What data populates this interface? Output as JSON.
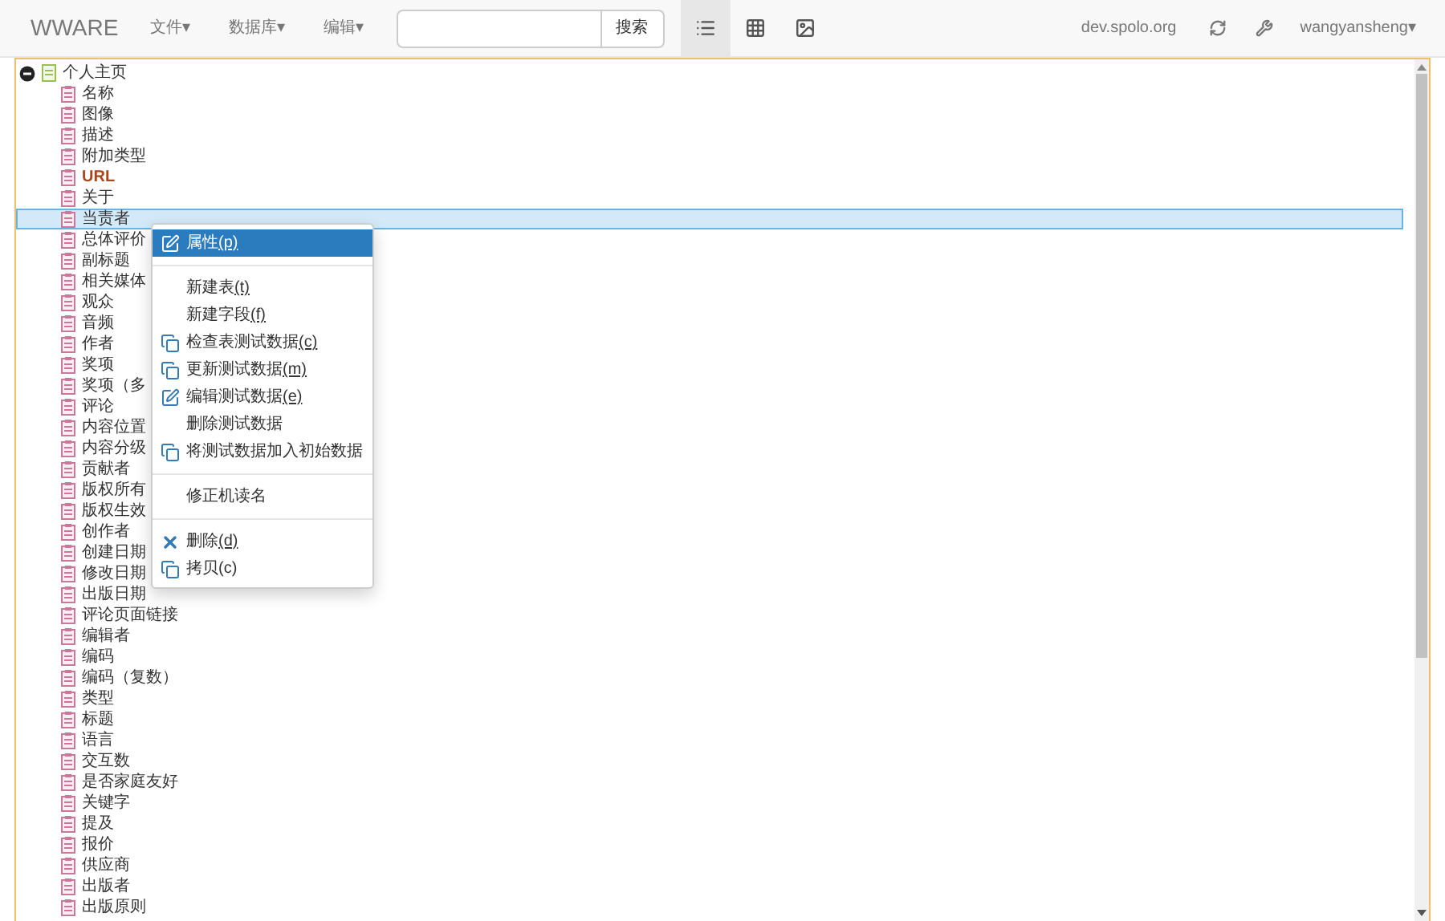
{
  "navbar": {
    "brand": "WWARE",
    "menus": [
      {
        "label": "文件",
        "caret": "▾"
      },
      {
        "label": "数据库",
        "caret": "▾"
      },
      {
        "label": "编辑",
        "caret": "▾"
      }
    ],
    "search": {
      "button": "搜索"
    },
    "views": [
      {
        "kind": "list",
        "selected": true
      },
      {
        "kind": "grid",
        "selected": false
      },
      {
        "kind": "image",
        "selected": false
      }
    ],
    "host": "dev.spolo.org",
    "user": {
      "name": "wangyansheng",
      "caret": "▾"
    }
  },
  "tree": {
    "label": "个人主页",
    "expanded": true,
    "children": [
      {
        "label": "名称",
        "emphasized": false,
        "selected": false
      },
      {
        "label": "图像",
        "emphasized": false,
        "selected": false
      },
      {
        "label": "描述",
        "emphasized": false,
        "selected": false
      },
      {
        "label": "附加类型",
        "emphasized": false,
        "selected": false
      },
      {
        "label": "URL",
        "emphasized": true,
        "selected": false
      },
      {
        "label": "关于",
        "emphasized": false,
        "selected": false
      },
      {
        "label": "当责者",
        "emphasized": false,
        "selected": true
      },
      {
        "label": "总体评价",
        "emphasized": false,
        "selected": false
      },
      {
        "label": "副标题",
        "emphasized": false,
        "selected": false
      },
      {
        "label": "相关媒体",
        "emphasized": false,
        "selected": false
      },
      {
        "label": "观众",
        "emphasized": false,
        "selected": false
      },
      {
        "label": "音频",
        "emphasized": false,
        "selected": false
      },
      {
        "label": "作者",
        "emphasized": false,
        "selected": false
      },
      {
        "label": "奖项",
        "emphasized": false,
        "selected": false
      },
      {
        "label": "奖项（多",
        "emphasized": false,
        "selected": false
      },
      {
        "label": "评论",
        "emphasized": false,
        "selected": false
      },
      {
        "label": "内容位置",
        "emphasized": false,
        "selected": false
      },
      {
        "label": "内容分级",
        "emphasized": false,
        "selected": false
      },
      {
        "label": "贡献者",
        "emphasized": false,
        "selected": false
      },
      {
        "label": "版权所有",
        "emphasized": false,
        "selected": false
      },
      {
        "label": "版权生效",
        "emphasized": false,
        "selected": false
      },
      {
        "label": "创作者",
        "emphasized": false,
        "selected": false
      },
      {
        "label": "创建日期",
        "emphasized": false,
        "selected": false
      },
      {
        "label": "修改日期",
        "emphasized": false,
        "selected": false
      },
      {
        "label": "出版日期",
        "emphasized": false,
        "selected": false
      },
      {
        "label": "评论页面链接",
        "emphasized": false,
        "selected": false
      },
      {
        "label": "编辑者",
        "emphasized": false,
        "selected": false
      },
      {
        "label": "编码",
        "emphasized": false,
        "selected": false
      },
      {
        "label": "编码（复数）",
        "emphasized": false,
        "selected": false
      },
      {
        "label": "类型",
        "emphasized": false,
        "selected": false
      },
      {
        "label": "标题",
        "emphasized": false,
        "selected": false
      },
      {
        "label": "语言",
        "emphasized": false,
        "selected": false
      },
      {
        "label": "交互数",
        "emphasized": false,
        "selected": false
      },
      {
        "label": "是否家庭友好",
        "emphasized": false,
        "selected": false
      },
      {
        "label": "关键字",
        "emphasized": false,
        "selected": false
      },
      {
        "label": "提及",
        "emphasized": false,
        "selected": false
      },
      {
        "label": "报价",
        "emphasized": false,
        "selected": false
      },
      {
        "label": "供应商",
        "emphasized": false,
        "selected": false
      },
      {
        "label": "出版者",
        "emphasized": false,
        "selected": false
      },
      {
        "label": "出版原则",
        "emphasized": false,
        "selected": false
      }
    ]
  },
  "context_menu": [
    {
      "kind": "edit",
      "label": "属性",
      "accelerator": "(p)",
      "selected": true
    },
    {
      "kind": "divider"
    },
    {
      "kind": "plain",
      "label": "新建表",
      "accelerator": "(t)",
      "selected": false
    },
    {
      "kind": "plain",
      "label": "新建字段",
      "accelerator": "(f)",
      "selected": false
    },
    {
      "kind": "copy",
      "label": "检查表测试数据",
      "accelerator": "(c)",
      "selected": false
    },
    {
      "kind": "copy",
      "label": "更新测试数据",
      "accelerator": "(m)",
      "selected": false
    },
    {
      "kind": "edit",
      "label": "编辑测试数据",
      "accelerator": "(e)",
      "selected": false
    },
    {
      "kind": "plain",
      "label": "删除测试数据",
      "selected": false
    },
    {
      "kind": "copy",
      "label": "将测试数据加入初始数据",
      "selected": false
    },
    {
      "kind": "divider"
    },
    {
      "kind": "plain",
      "label": "修正机读名",
      "selected": false
    },
    {
      "kind": "divider"
    },
    {
      "kind": "delete",
      "label": "删除",
      "accelerator": "(d)",
      "selected": false
    },
    {
      "kind": "copy",
      "label": "拷贝(c)",
      "selected": false
    }
  ]
}
